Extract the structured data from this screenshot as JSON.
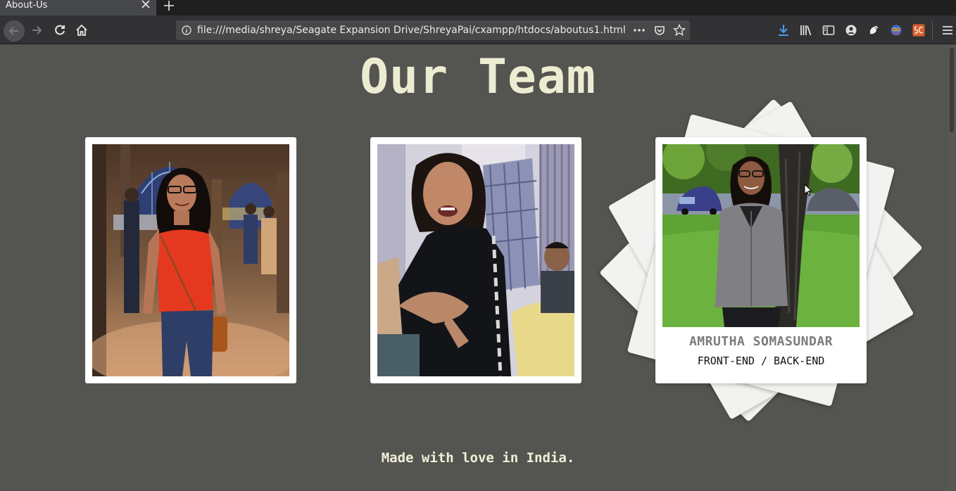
{
  "browser": {
    "tab_title": "About-Us",
    "url": "file:///media/shreya/Seagate Expansion Drive/ShreyaPai/cxampp/htdocs/aboutus1.html",
    "toolbar_icons": [
      "download-icon",
      "library-icon",
      "sidebar-icon",
      "account-icon",
      "extension-icon",
      "extension-icon",
      "extension-icon",
      "menu-icon"
    ]
  },
  "page": {
    "title": "Our Team",
    "footer": "Made with love in India.",
    "background_color": "#545450",
    "title_color": "#ececd2",
    "members": [
      {
        "photo": "team-member-photo-1"
      },
      {
        "photo": "team-member-photo-2"
      },
      {
        "photo": "team-member-photo-3",
        "name": "AMRUTHA SOMASUNDAR",
        "role": "FRONT-END / BACK-END"
      }
    ]
  }
}
